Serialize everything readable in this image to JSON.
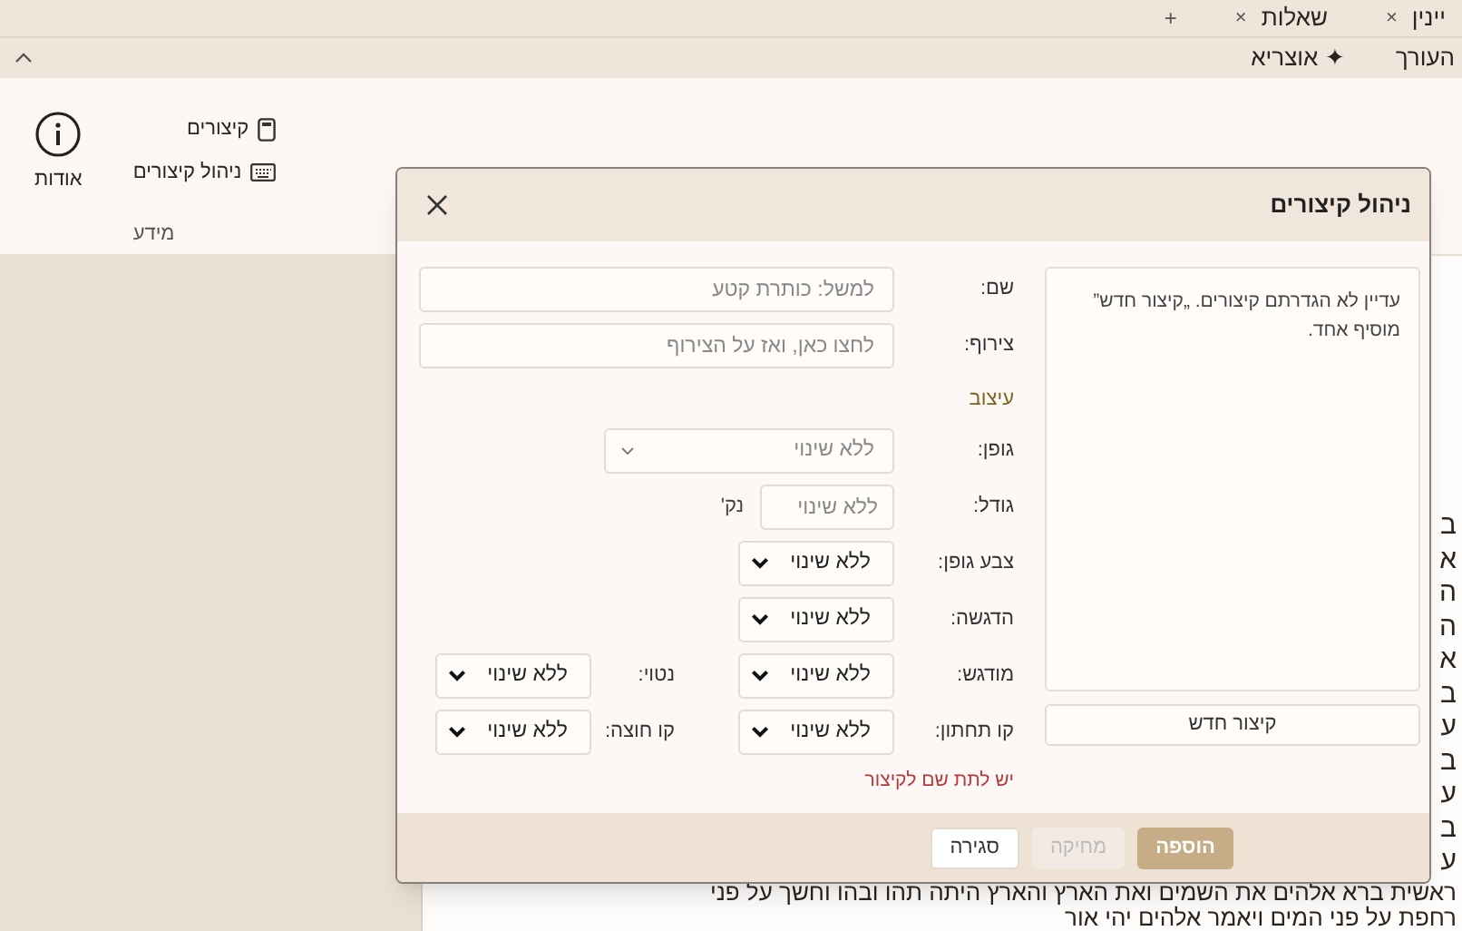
{
  "tabs": [
    {
      "label": "יינין",
      "close": "×"
    },
    {
      "label": "שאלות",
      "close": "×"
    }
  ],
  "new_tab": "+",
  "menu": [
    {
      "label": "העורך"
    },
    {
      "label": "אוצריא",
      "icon": "✦"
    }
  ],
  "ribbon": {
    "about": "אודות",
    "items": [
      {
        "label": "קיצורים",
        "kind": "device"
      },
      {
        "label": "ניהול קיצורים",
        "kind": "keyboard"
      }
    ],
    "group_label": "מידע"
  },
  "document": {
    "fragments": [
      "ב",
      "א",
      "ה",
      "ה",
      "א",
      "ב",
      "ע",
      "ב",
      "ע",
      "ב",
      "ע"
    ],
    "lines": [
      "ראשית ברא אלהים את השמים ואת הארץ והארץ היתה תהו ובהו וחשך על פני",
      "רחפת על פני המים ויאמר אלהים יהי אור"
    ]
  },
  "dialog": {
    "title": "ניהול קיצורים",
    "list_message": "עדיין לא הגדרתם קיצורים. „קיצור חדש” מוסיף אחד.",
    "new_button": "קיצור חדש",
    "rows": [
      {
        "kind": "field",
        "fields": [
          {
            "label": "שם:",
            "kind": "text",
            "placeholder": "למשל: כותרת קטע"
          }
        ]
      },
      {
        "kind": "field",
        "fields": [
          {
            "label": "צירוף:",
            "kind": "text",
            "placeholder": "לחצו כאן, ואז על הצירוף"
          }
        ]
      },
      {
        "kind": "section",
        "label": "עיצוב"
      },
      {
        "kind": "field",
        "fields": [
          {
            "label": "גופן:",
            "kind": "combo",
            "placeholder": "ללא שינוי"
          }
        ]
      },
      {
        "kind": "field",
        "fields": [
          {
            "label": "גודל:",
            "kind": "size",
            "placeholder": "ללא שינוי",
            "unit": "נק'"
          }
        ]
      },
      {
        "kind": "field",
        "fields": [
          {
            "label": "צבע גופן:",
            "kind": "select",
            "value": "ללא שינוי"
          }
        ]
      },
      {
        "kind": "field",
        "fields": [
          {
            "label": "הדגשה:",
            "kind": "select",
            "value": "ללא שינוי"
          }
        ]
      },
      {
        "kind": "field",
        "fields": [
          {
            "label": "מודגש:",
            "kind": "select",
            "value": "ללא שינוי"
          },
          {
            "label": "נטוי:",
            "kind": "select",
            "value": "ללא שינוי"
          }
        ]
      },
      {
        "kind": "field",
        "fields": [
          {
            "label": "קו תחתון:",
            "kind": "select",
            "value": "ללא שינוי"
          },
          {
            "label": "קו חוצה:",
            "kind": "select",
            "value": "ללא שינוי"
          }
        ]
      }
    ],
    "error": "יש לתת שם לקיצור",
    "buttons": [
      {
        "label": "הוספה",
        "kind": "primary",
        "disabled": false
      },
      {
        "label": "מחיקה",
        "kind": "secondary",
        "disabled": true
      },
      {
        "label": "סגירה",
        "kind": "secondary",
        "disabled": false
      }
    ]
  }
}
